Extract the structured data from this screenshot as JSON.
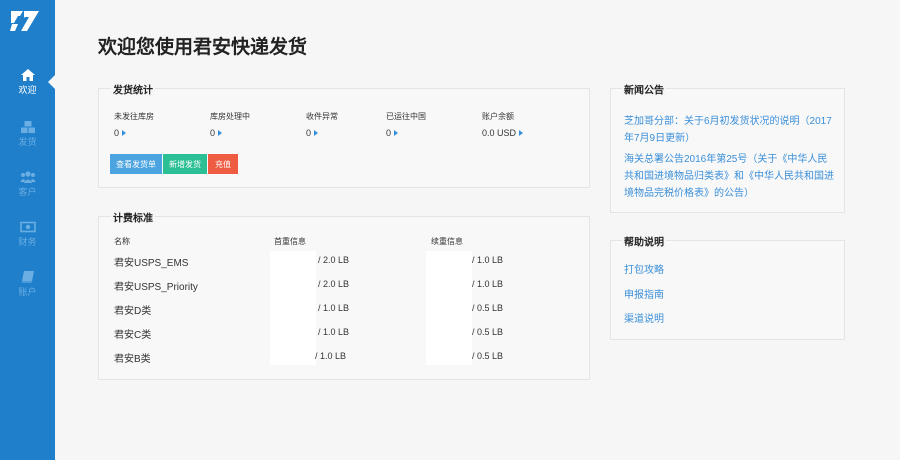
{
  "sidebar": {
    "items": [
      {
        "label": "欢迎",
        "icon": "home-icon",
        "active": true
      },
      {
        "label": "发货",
        "icon": "cubes-icon",
        "active": false
      },
      {
        "label": "客户",
        "icon": "users-icon",
        "active": false
      },
      {
        "label": "财务",
        "icon": "money-icon",
        "active": false
      },
      {
        "label": "账户",
        "icon": "book-icon",
        "active": false
      }
    ]
  },
  "page_title": "欢迎您使用君安快递发货",
  "shipping_stats": {
    "title": "发货统计",
    "stats": [
      {
        "label": "未发往库房",
        "value": "0"
      },
      {
        "label": "库房处理中",
        "value": "0"
      },
      {
        "label": "收件异常",
        "value": "0"
      },
      {
        "label": "已运往中国",
        "value": "0"
      },
      {
        "label": "账户余额",
        "value": "0.0 USD"
      }
    ],
    "buttons": [
      {
        "label": "查看发货单",
        "color": "#4ba3e0"
      },
      {
        "label": "新增发货",
        "color": "#2bbf95"
      },
      {
        "label": "充值",
        "color": "#ee5c43"
      }
    ]
  },
  "fee_standard": {
    "title": "计费标准",
    "headers": [
      "名称",
      "首重信息",
      "续重信息"
    ],
    "rows": [
      {
        "name": "君安USPS_EMS",
        "first": "/ 2.0 LB",
        "extra": "/ 1.0 LB"
      },
      {
        "name": "君安USPS_Priority",
        "first": "/ 2.0 LB",
        "extra": "/ 1.0 LB"
      },
      {
        "name": "君安D类",
        "first": "/ 1.0 LB",
        "extra": "/ 0.5 LB"
      },
      {
        "name": "君安C类",
        "first": "/ 1.0 LB",
        "extra": "/ 0.5 LB"
      },
      {
        "name": "君安B类",
        "first": "/ 1.0 LB",
        "extra": "/ 0.5 LB"
      }
    ]
  },
  "news": {
    "title": "新闻公告",
    "items": [
      "芝加哥分部：关于6月初发货状况的说明（2017年7月9日更新）",
      "海关总署公告2016年第25号（关于《中华人民共和国进境物品归类表》和《中华人民共和国进境物品完税价格表》的公告）"
    ]
  },
  "help": {
    "title": "帮助说明",
    "items": [
      "打包攻略",
      "申报指南",
      "渠道说明"
    ]
  },
  "colors": {
    "sidebar": "#1f7fcb",
    "link": "#3a8fd8"
  }
}
